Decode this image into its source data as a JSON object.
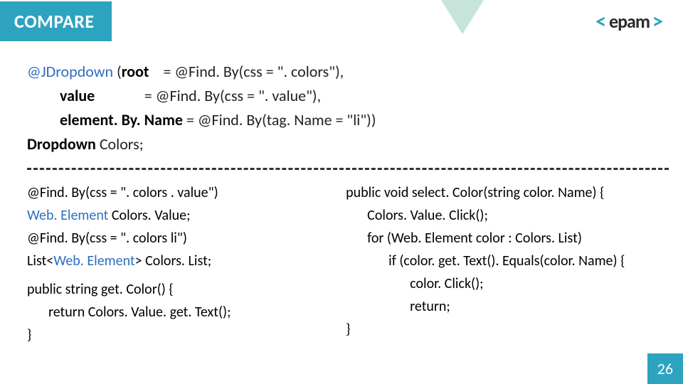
{
  "header": {
    "title": "COMPARE"
  },
  "logo": {
    "left": "<",
    "name": "epam",
    "right": ">"
  },
  "top": {
    "l1a": "@JDropdown ",
    "l1b": "(",
    "l1c": "root",
    "l1d": "    = @Find. By(css = \". colors\"),",
    "l2a": "value",
    "l2b": "              = @Find. By(css = \". value\"),",
    "l3a": "element. By. Name",
    "l3b": " = @Find. By(tag. Name = \"li\"))",
    "l4a": "Dropdown",
    "l4b": " Colors;"
  },
  "left": {
    "l1": "@Find. By(css = \". colors . value\")",
    "l2a": "Web. Element",
    "l2b": " Colors. Value;",
    "l3": "@Find. By(css = \". colors li\")",
    "l4a": "List<",
    "l4b": "Web. Element",
    "l4c": "> Colors. List;",
    "l5": "public string get. Color() {",
    "l6": "return Colors. Value. get. Text();",
    "l7": "}"
  },
  "right": {
    "l1": "public void select. Color(string color. Name) {",
    "l2": "Colors. Value. Click();",
    "l3": "for (Web. Element color : Colors. List)",
    "l4": "if (color. get. Text(). Equals(color. Name) {",
    "l5": "color. Click();",
    "l6": "return;",
    "l7": "}"
  },
  "page": "26"
}
